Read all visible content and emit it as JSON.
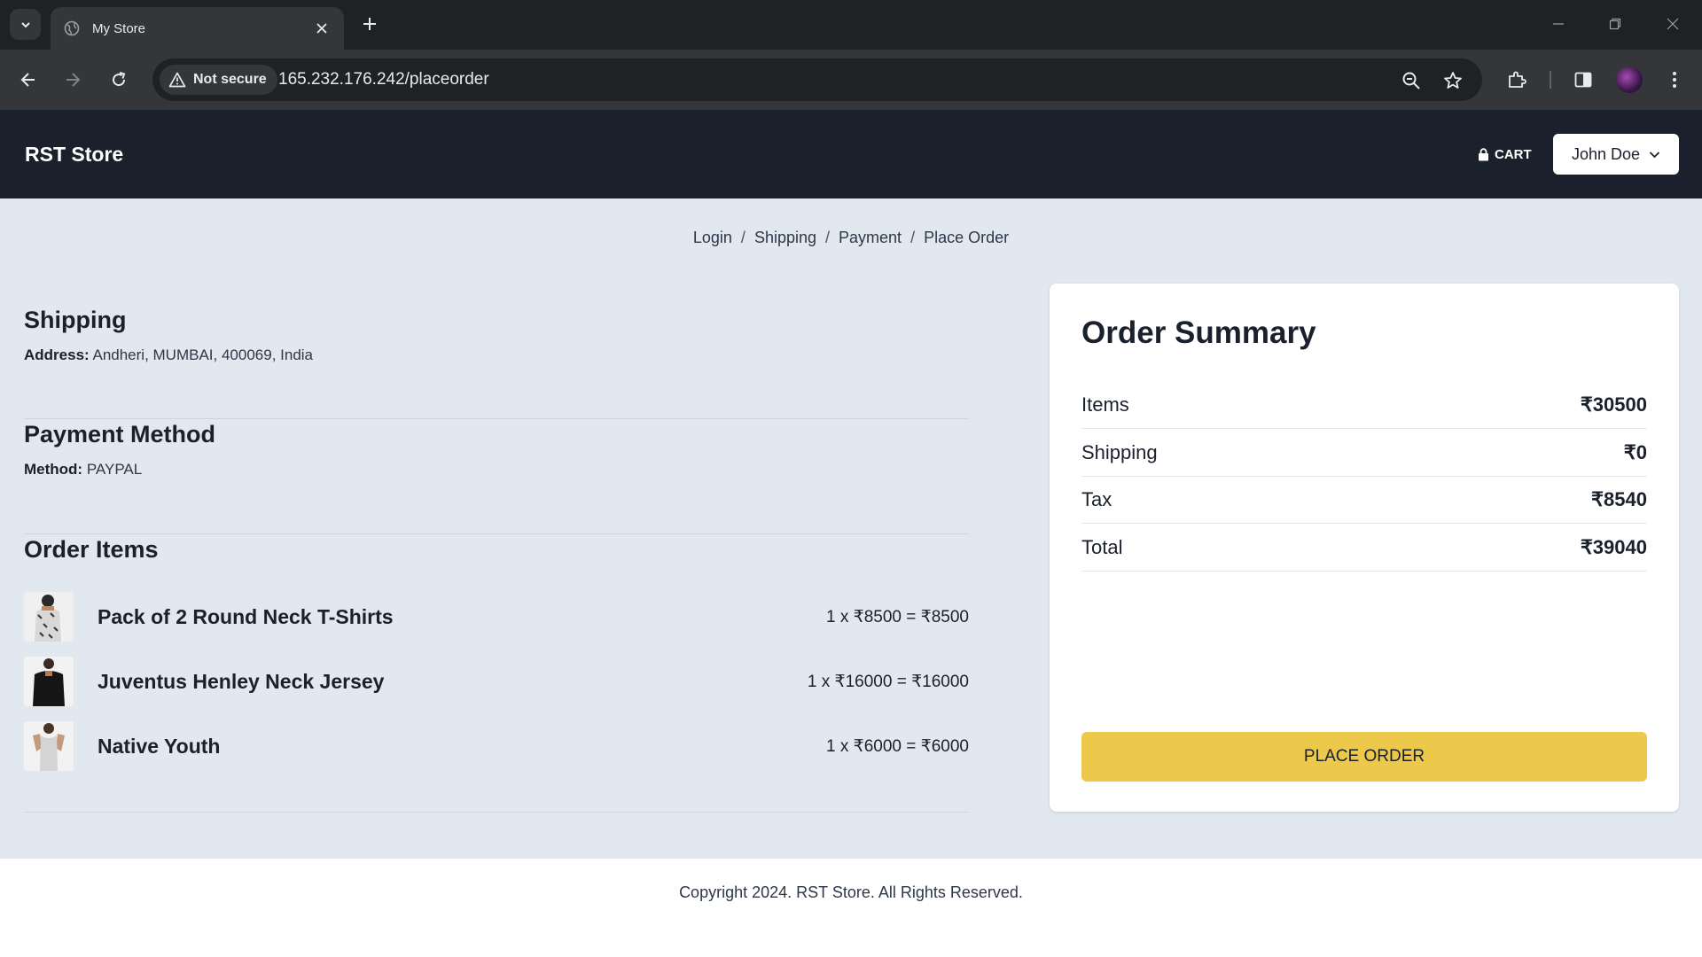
{
  "browser": {
    "tab_title": "My Store",
    "security_label": "Not secure",
    "url": "165.232.176.242/placeorder",
    "icons": [
      "tab-search-icon",
      "globe-icon",
      "close-icon",
      "plus-icon",
      "minimize-icon",
      "restore-icon",
      "window-close-icon",
      "back-icon",
      "forward-icon",
      "reload-icon",
      "warning-icon",
      "zoom-icon",
      "star-icon",
      "extensions-icon",
      "side-panel-icon",
      "menu-icon"
    ]
  },
  "navbar": {
    "brand": "RST Store",
    "cart_label": "CART",
    "user_name": "John Doe"
  },
  "breadcrumb": {
    "steps": [
      "Login",
      "Shipping",
      "Payment",
      "Place Order"
    ],
    "separator": "/"
  },
  "shipping": {
    "title": "Shipping",
    "address_label": "Address:",
    "address_value": "Andheri, MUMBAI, 400069, India"
  },
  "payment": {
    "title": "Payment Method",
    "method_label": "Method:",
    "method_value": "PAYPAL"
  },
  "order_items": {
    "title": "Order Items",
    "items": [
      {
        "name": "Pack of 2 Round Neck T-Shirts",
        "calc": "1 x ₹8500 = ₹8500"
      },
      {
        "name": "Juventus Henley Neck Jersey",
        "calc": "1 x ₹16000 = ₹16000"
      },
      {
        "name": "Native Youth",
        "calc": "1 x ₹6000 = ₹6000"
      }
    ]
  },
  "summary": {
    "title": "Order Summary",
    "rows": [
      {
        "label": "Items",
        "value": "₹30500"
      },
      {
        "label": "Shipping",
        "value": "₹0"
      },
      {
        "label": "Tax",
        "value": "₹8540"
      },
      {
        "label": "Total",
        "value": "₹39040"
      }
    ],
    "button_label": "PLACE ORDER"
  },
  "footer": {
    "text": "Copyright 2024. RST Store. All Rights Reserved."
  },
  "colors": {
    "navbar_bg": "#1a202c",
    "page_bg": "#e2e8f0",
    "button_bg": "#ecc94b"
  }
}
